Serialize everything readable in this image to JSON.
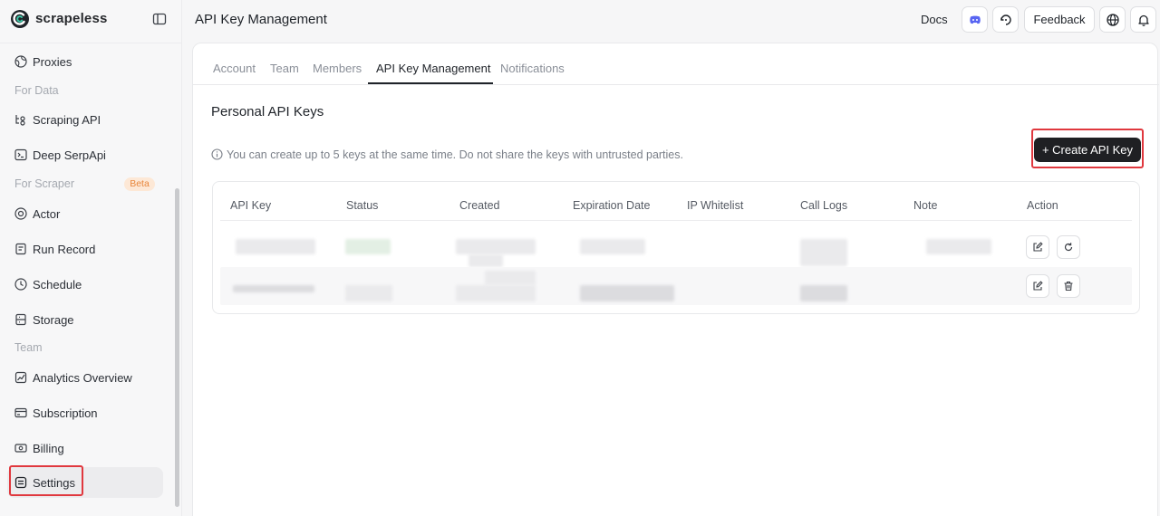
{
  "app": {
    "logo_text": "scrapeless"
  },
  "header": {
    "title": "API Key Management",
    "docs_label": "Docs",
    "feedback_label": "Feedback"
  },
  "sidebar": {
    "items": [
      {
        "label": "Proxies",
        "icon": "globe-icon"
      },
      {
        "section": "For Data"
      },
      {
        "label": "Scraping API",
        "icon": "api-flow-icon"
      },
      {
        "label": "Deep SerpApi",
        "icon": "terminal-icon"
      },
      {
        "section": "For Scraper",
        "badge": "Beta"
      },
      {
        "label": "Actor",
        "icon": "actor-icon"
      },
      {
        "label": "Run Record",
        "icon": "record-icon"
      },
      {
        "label": "Schedule",
        "icon": "clock-icon"
      },
      {
        "label": "Storage",
        "icon": "database-icon"
      },
      {
        "section": "Team"
      },
      {
        "label": "Analytics Overview",
        "icon": "analytics-icon"
      },
      {
        "label": "Subscription",
        "icon": "subscription-icon"
      },
      {
        "label": "Billing",
        "icon": "billing-icon"
      },
      {
        "label": "Settings",
        "icon": "settings-icon",
        "active": true
      }
    ]
  },
  "tabs": [
    {
      "label": "Account"
    },
    {
      "label": "Team"
    },
    {
      "label": "Members"
    },
    {
      "label": "API Key Management",
      "active": true
    },
    {
      "label": "Notifications"
    }
  ],
  "content": {
    "section_title": "Personal API Keys",
    "info_text": "You can create up to 5 keys at the same time. Do not share the keys with untrusted parties.",
    "create_button": "+ Create API Key"
  },
  "table": {
    "columns": [
      "API Key",
      "Status",
      "Created",
      "Expiration Date",
      "IP Whitelist",
      "Call Logs",
      "Note",
      "Action"
    ],
    "rows": [
      {
        "redacted": true,
        "actions": [
          "edit-icon",
          "refresh-icon"
        ]
      },
      {
        "redacted": true,
        "actions": [
          "edit-icon",
          "trash-icon"
        ]
      }
    ]
  },
  "colors": {
    "accent_dark": "#1f2023",
    "highlight_red": "#e0383e",
    "discord_blue": "#5865f2",
    "beta_badge_bg": "#fde8d6",
    "beta_badge_text": "#e8873d"
  }
}
